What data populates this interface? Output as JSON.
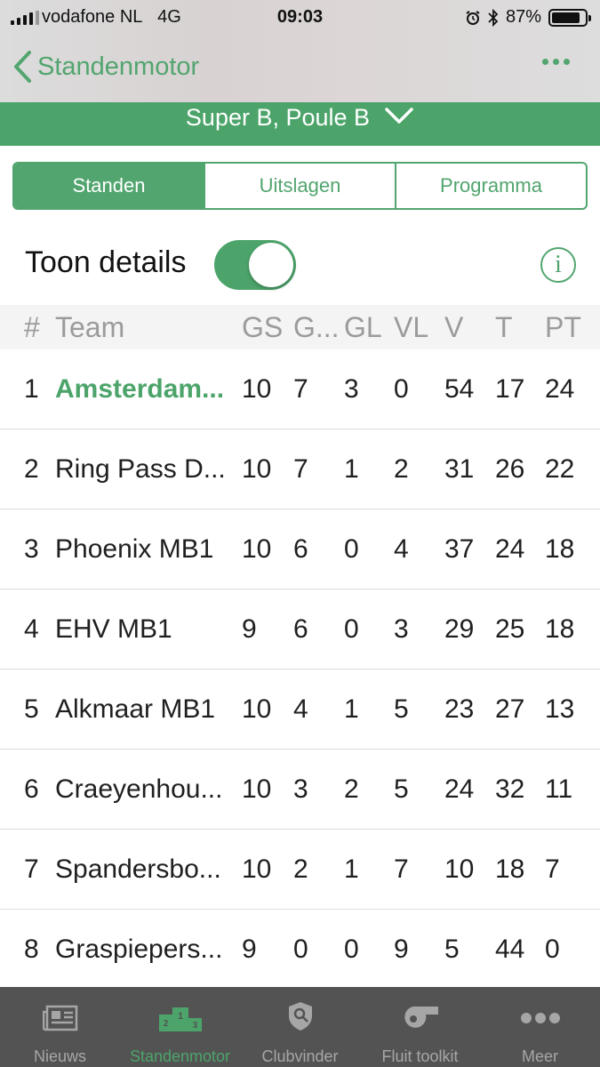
{
  "status": {
    "carrier": "vodafone NL",
    "network": "4G",
    "time": "09:03",
    "battery": "87%",
    "battery_fraction": 0.87
  },
  "nav": {
    "back_label": "Standenmotor"
  },
  "competition": {
    "title": "Super B, Poule B"
  },
  "segments": [
    {
      "label": "Standen",
      "active": true
    },
    {
      "label": "Uitslagen",
      "active": false
    },
    {
      "label": "Programma",
      "active": false
    }
  ],
  "toggle": {
    "label": "Toon details",
    "on": true
  },
  "table": {
    "headers": {
      "pos": "#",
      "team": "Team",
      "gs": "GS",
      "g": "G...",
      "gl": "GL",
      "vl": "VL",
      "v": "V",
      "t": "T",
      "pt": "PT"
    },
    "rows": [
      {
        "pos": "1",
        "team": "Amsterdam...",
        "gs": "10",
        "g": "7",
        "gl": "3",
        "vl": "0",
        "v": "54",
        "t": "17",
        "pt": "24"
      },
      {
        "pos": "2",
        "team": "Ring Pass D...",
        "gs": "10",
        "g": "7",
        "gl": "1",
        "vl": "2",
        "v": "31",
        "t": "26",
        "pt": "22"
      },
      {
        "pos": "3",
        "team": "Phoenix MB1",
        "gs": "10",
        "g": "6",
        "gl": "0",
        "vl": "4",
        "v": "37",
        "t": "24",
        "pt": "18"
      },
      {
        "pos": "4",
        "team": "EHV MB1",
        "gs": "9",
        "g": "6",
        "gl": "0",
        "vl": "3",
        "v": "29",
        "t": "25",
        "pt": "18"
      },
      {
        "pos": "5",
        "team": "Alkmaar MB1",
        "gs": "10",
        "g": "4",
        "gl": "1",
        "vl": "5",
        "v": "23",
        "t": "27",
        "pt": "13"
      },
      {
        "pos": "6",
        "team": "Craeyenhou...",
        "gs": "10",
        "g": "3",
        "gl": "2",
        "vl": "5",
        "v": "24",
        "t": "32",
        "pt": "11"
      },
      {
        "pos": "7",
        "team": "Spandersbo...",
        "gs": "10",
        "g": "2",
        "gl": "1",
        "vl": "7",
        "v": "10",
        "t": "18",
        "pt": "7"
      },
      {
        "pos": "8",
        "team": "Graspiepers...",
        "gs": "9",
        "g": "0",
        "gl": "0",
        "vl": "9",
        "v": "5",
        "t": "44",
        "pt": "0"
      }
    ]
  },
  "tabbar": [
    {
      "label": "Nieuws",
      "icon": "newspaper-icon",
      "active": false
    },
    {
      "label": "Standenmotor",
      "icon": "podium-icon",
      "active": true
    },
    {
      "label": "Clubvinder",
      "icon": "shield-search-icon",
      "active": false
    },
    {
      "label": "Fluit toolkit",
      "icon": "whistle-icon",
      "active": false
    },
    {
      "label": "Meer",
      "icon": "more-dots-icon",
      "active": false
    }
  ],
  "colors": {
    "accent": "#4ca46a",
    "tabbar_bg": "#535353"
  }
}
